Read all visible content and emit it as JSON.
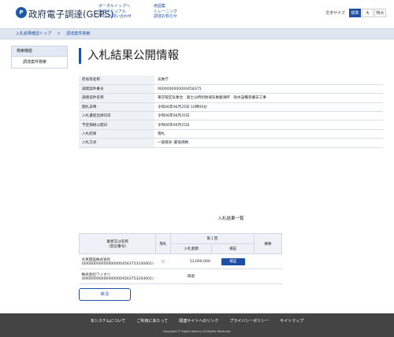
{
  "header": {
    "logo_text": "P",
    "site_title": "政府電子調達(GEPS)",
    "nav_col1": [
      "ポータルトップへ",
      "操作マニュアル",
      "FAQ･お問い合わせ"
    ],
    "nav_col2": [
      "用語集",
      "トレーニング",
      "調達お知らせ"
    ],
    "font_size_label": "文字サイズ",
    "font_sizes": [
      "標準",
      "大",
      "特大"
    ],
    "accent_color": "#1e4fa8"
  },
  "breadcrumb": {
    "items": [
      "入札結果確認トップ",
      "調達案件検索"
    ],
    "separator": ">"
  },
  "sidebar": {
    "heading": "検索機能",
    "items": [
      "調達案件検索"
    ]
  },
  "main": {
    "page_title": "入札結果公開情報",
    "info_rows": [
      {
        "label": "府省等名称",
        "value": "気象庁"
      },
      {
        "label": "調達案件番号",
        "value": "0000000000000458375"
      },
      {
        "label": "調達案件名称",
        "value": "東京管区気象台　富士山特別地域気象観測所　除水設備等撤去工事"
      },
      {
        "label": "開札日時",
        "value": "令和06年06月25日 10時00分"
      },
      {
        "label": "入札書提出締切日",
        "value": "令和06年06月25日"
      },
      {
        "label": "予定価格公開日",
        "value": "令和06年06月25日"
      },
      {
        "label": "入札結果",
        "value": "落札"
      },
      {
        "label": "入札方式",
        "value": "一般競争･最低価格"
      }
    ],
    "result_caption": "入札結果一覧",
    "result_table": {
      "header_name": "業者又は名称\n(登記番号)",
      "header_award": "落札",
      "header_round": "第１回",
      "header_amount": "入札金額",
      "header_check": "検証",
      "header_remarks": "摘要",
      "rows": [
        {
          "name": "大英建設株式会社",
          "number": "(000000000000000004563753100001)",
          "award": "○",
          "amount": "13,000,000",
          "check": "検証",
          "remarks": ""
        },
        {
          "name": "株式会社ワイオリ",
          "number": "(000000000000000004563753204001)",
          "award": "",
          "amount": "辞退",
          "check": "",
          "remarks": ""
        }
      ]
    },
    "back_label": "戻る"
  },
  "footer": {
    "links": [
      "本システムについて",
      "ご利用にあたって",
      "関連サイトへのリンク",
      "プライバシーポリシー",
      "サイトマップ"
    ],
    "copyright": "Copyright © Digital Agency All Rights Reserved."
  }
}
